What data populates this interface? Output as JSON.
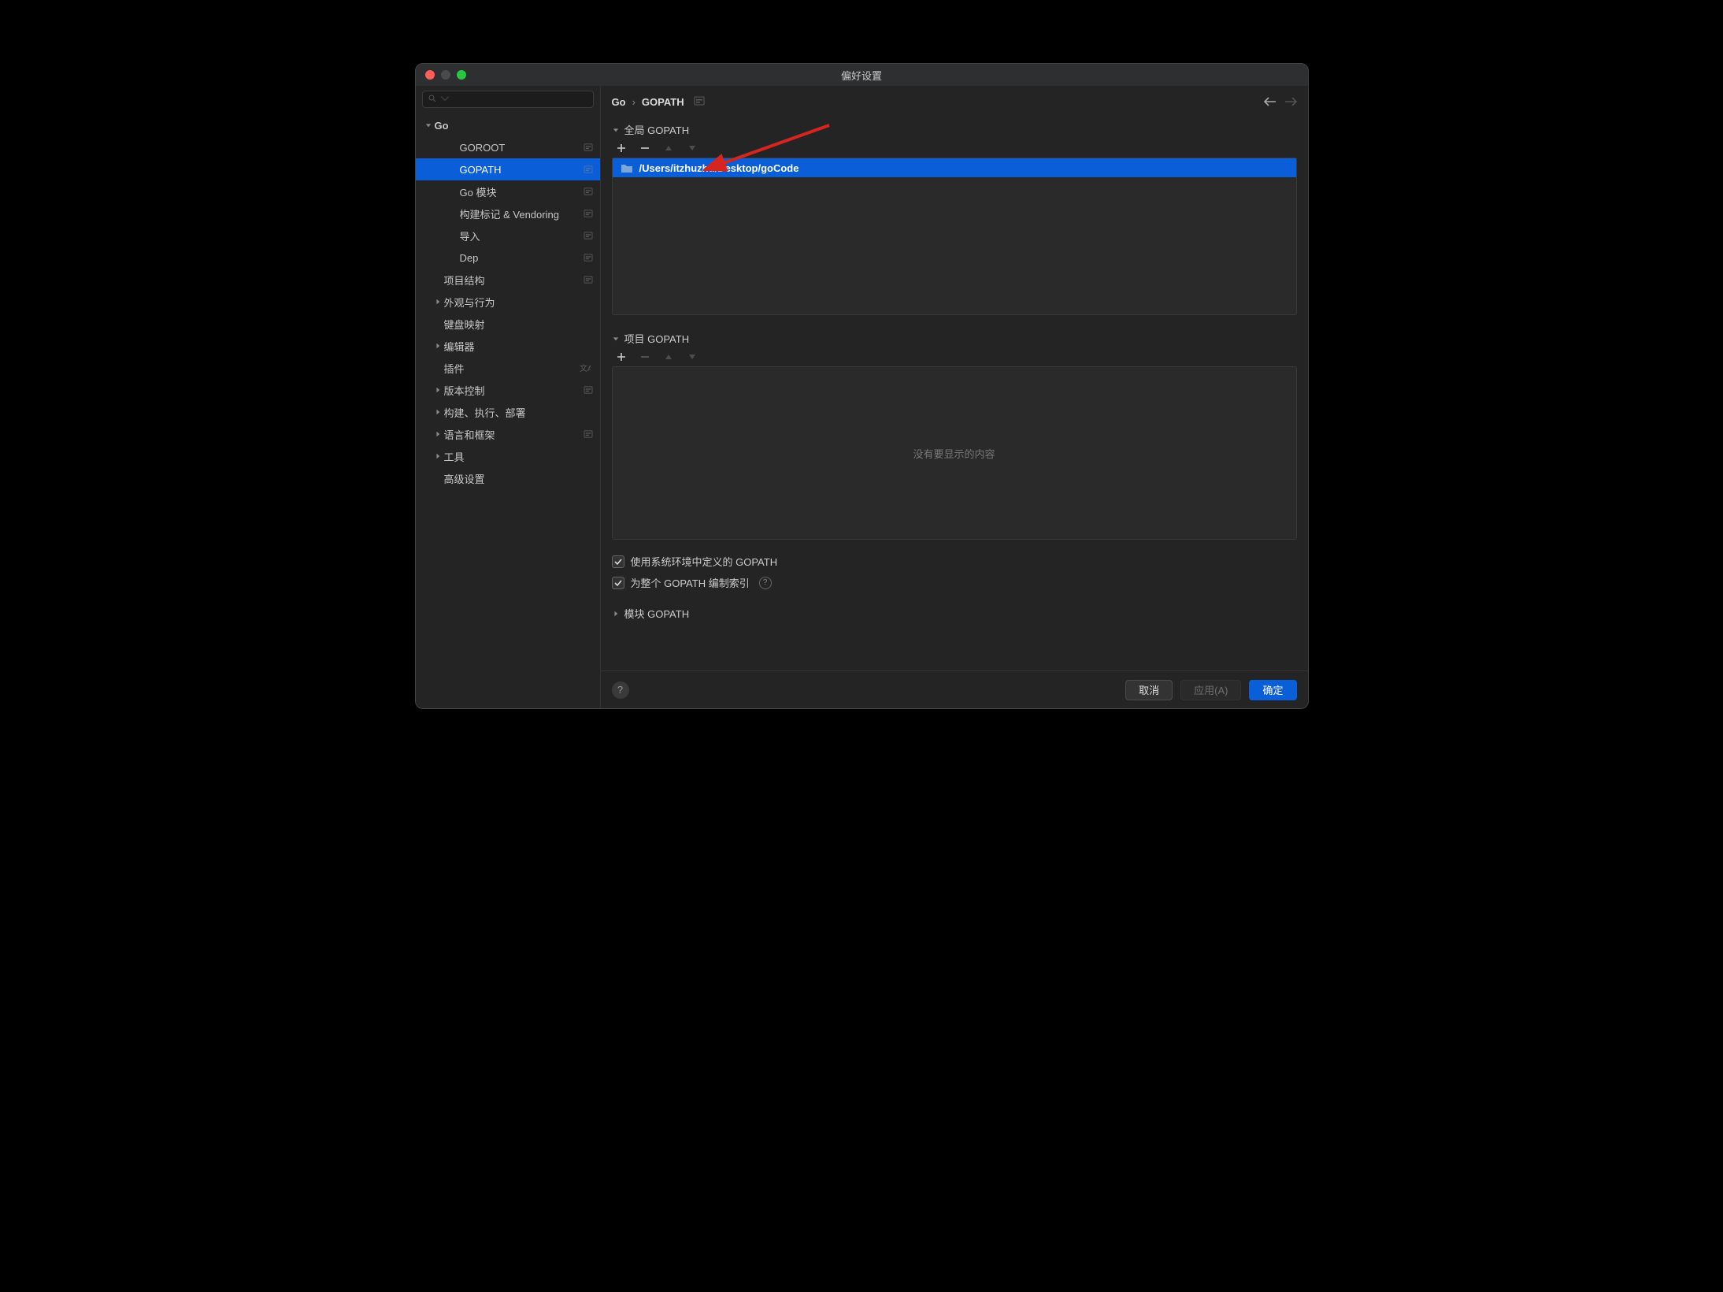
{
  "window": {
    "title": "偏好设置"
  },
  "breadcrumb": {
    "root": "Go",
    "leaf": "GOPATH"
  },
  "sidebar": {
    "items": [
      {
        "label": "Go",
        "depth": 0,
        "expanded": true,
        "bold": true
      },
      {
        "label": "GOROOT",
        "depth": 2,
        "badge": true
      },
      {
        "label": "GOPATH",
        "depth": 2,
        "badge": true,
        "selected": true
      },
      {
        "label": "Go 模块",
        "depth": 2,
        "badge": true
      },
      {
        "label": "构建标记 & Vendoring",
        "depth": 2,
        "badge": true
      },
      {
        "label": "导入",
        "depth": 2,
        "badge": true
      },
      {
        "label": "Dep",
        "depth": 2,
        "badge": true
      },
      {
        "label": "项目结构",
        "depth": 1,
        "badge": true
      },
      {
        "label": "外观与行为",
        "depth": 1,
        "chevron": true
      },
      {
        "label": "键盘映射",
        "depth": 1
      },
      {
        "label": "编辑器",
        "depth": 1,
        "chevron": true
      },
      {
        "label": "插件",
        "depth": 1,
        "lang": true
      },
      {
        "label": "版本控制",
        "depth": 1,
        "chevron": true,
        "badge": true
      },
      {
        "label": "构建、执行、部署",
        "depth": 1,
        "chevron": true
      },
      {
        "label": "语言和框架",
        "depth": 1,
        "chevron": true,
        "badge": true
      },
      {
        "label": "工具",
        "depth": 1,
        "chevron": true
      },
      {
        "label": "高级设置",
        "depth": 1
      }
    ]
  },
  "sections": {
    "global": {
      "title": "全局 GOPATH",
      "entries": [
        "/Users/itzhuzhu/Desktop/goCode"
      ]
    },
    "project": {
      "title": "项目 GOPATH",
      "empty_text": "没有要显示的内容"
    },
    "module": {
      "title": "模块 GOPATH"
    }
  },
  "checks": {
    "use_system": "使用系统环境中定义的 GOPATH",
    "index_all": "为整个 GOPATH 编制索引"
  },
  "footer": {
    "cancel": "取消",
    "apply": "应用(A)",
    "ok": "确定"
  }
}
